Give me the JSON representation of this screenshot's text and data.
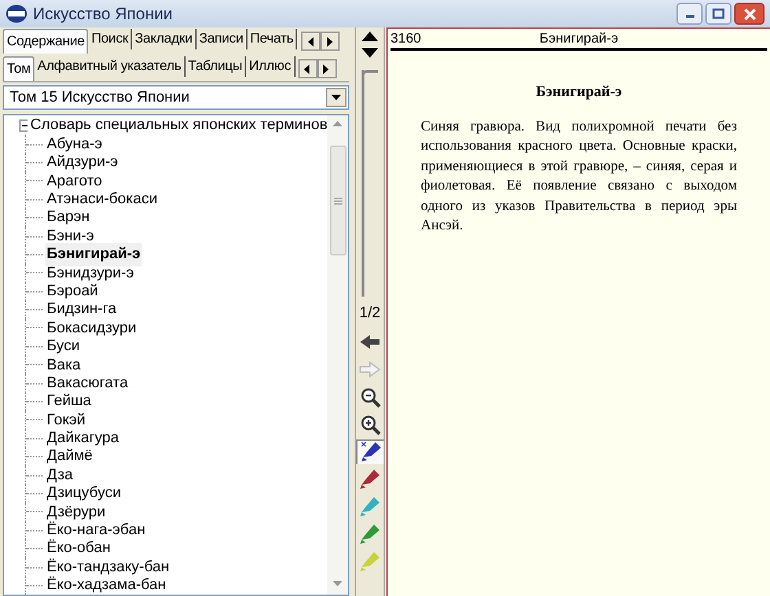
{
  "window": {
    "title": "Искусство Японии"
  },
  "tabs": [
    {
      "label": "Содержание",
      "selected": true
    },
    {
      "label": "Поиск",
      "selected": false
    },
    {
      "label": "Закладки",
      "selected": false
    },
    {
      "label": "Записи",
      "selected": false
    },
    {
      "label": "Печать",
      "selected": false
    }
  ],
  "subtabs": [
    {
      "label": "Том",
      "selected": true
    },
    {
      "label": "Алфавитный указатель",
      "selected": false
    },
    {
      "label": "Таблицы",
      "selected": false
    },
    {
      "label": "Иллюс",
      "selected": false
    }
  ],
  "volume_select": {
    "value": "Том 15 Искусство Японии"
  },
  "tree": {
    "label": "Словарь специальных японских терминов",
    "expanded": true,
    "children": [
      {
        "label": "Абуна-э",
        "selected": false
      },
      {
        "label": "Айдзури-э",
        "selected": false
      },
      {
        "label": "Арагото",
        "selected": false
      },
      {
        "label": "Атэнаси-бокаси",
        "selected": false
      },
      {
        "label": "Барэн",
        "selected": false
      },
      {
        "label": "Бэни-э",
        "selected": false
      },
      {
        "label": "Бэнигирай-э",
        "selected": true
      },
      {
        "label": "Бэнидзури-э",
        "selected": false
      },
      {
        "label": "Бэроай",
        "selected": false
      },
      {
        "label": "Бидзин-га",
        "selected": false
      },
      {
        "label": "Бокасидзури",
        "selected": false
      },
      {
        "label": "Буси",
        "selected": false
      },
      {
        "label": "Вака",
        "selected": false
      },
      {
        "label": "Вакасюгата",
        "selected": false
      },
      {
        "label": "Гейша",
        "selected": false
      },
      {
        "label": "Гокэй",
        "selected": false
      },
      {
        "label": "Дайкагура",
        "selected": false
      },
      {
        "label": "Даймё",
        "selected": false
      },
      {
        "label": "Дза",
        "selected": false
      },
      {
        "label": "Дзицубуси",
        "selected": false
      },
      {
        "label": "Дзёрури",
        "selected": false
      },
      {
        "label": "Ёко-нага-эбан",
        "selected": false
      },
      {
        "label": "Ёко-обан",
        "selected": false
      },
      {
        "label": "Ёко-тандзаку-бан",
        "selected": false
      },
      {
        "label": "Ёко-хадзама-бан",
        "selected": false
      }
    ]
  },
  "page_slider": {
    "level": 0
  },
  "page_indicator": "1/2",
  "tools": [
    {
      "kind": "back",
      "disabled": false
    },
    {
      "kind": "forward",
      "disabled": true
    },
    {
      "kind": "zoom_out",
      "disabled": false
    },
    {
      "kind": "zoom_in",
      "disabled": false
    },
    {
      "kind": "marker",
      "color": "#2b35b8",
      "selected": true
    },
    {
      "kind": "marker",
      "color": "#b0283a",
      "selected": false
    },
    {
      "kind": "marker",
      "color": "#2fb3c0",
      "selected": false
    },
    {
      "kind": "marker",
      "color": "#2e9a3a",
      "selected": false
    },
    {
      "kind": "marker",
      "color": "#c8d23a",
      "selected": false
    }
  ],
  "article": {
    "page_number": "3160",
    "header_title": "Бэнигирай-э",
    "title": "Бэнигирай-э",
    "body": "Синяя гравюра. Вид полихромной печати без использования красного цвета. Основные краски, применяющиеся в этой гравюре, – синяя, серая и фиолетовая. Её появление связано с выходом одного из указов Правительства в период эры Ансэй."
  }
}
